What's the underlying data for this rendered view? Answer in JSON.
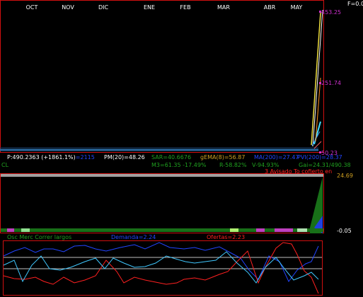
{
  "corner_label": "F=0.0",
  "months": [
    "OCT",
    "NOV",
    "DIC",
    "ENE",
    "FEB",
    "MAR",
    "ABR",
    "MAY"
  ],
  "price_axis": {
    "top": "453.25",
    "mid": "251.74",
    "bottom": "50.23",
    "marker_color": "#d030d0"
  },
  "info_line1": {
    "price": "P:490.2363 (+1861.1%)",
    "price_hidden": "=2115",
    "pm": "PM(20)=48.26",
    "sar": "SAR=40.6676",
    "gema": "gEMA(8)=56.87",
    "ma": "MA(200)=27.47",
    "pvi": "PVI(200)=28.37"
  },
  "info_line2": {
    "cl": "CL",
    "m3": "M3=61.35 -17.49%",
    "r": "R-58.82%",
    "v": "V-94.93%",
    "gai": "Gai=24.31/490.38"
  },
  "volume_panel": {
    "note": "3 Avisado To cofierto en",
    "axis_top": "24.69",
    "axis_bottom": "-0.05"
  },
  "oscillator": {
    "label": "Osc Merc Correr largos",
    "demanda": "Demanda=2.24",
    "ofertas": "Ofertas=2.23"
  },
  "colors": {
    "frame_red": "#d01010",
    "demand_blue": "#2244ff",
    "offer_red": "#ff2020",
    "cyan": "#40c8ff",
    "gold": "#d0a020",
    "green": "#20a020",
    "magenta": "#d030d0"
  }
}
